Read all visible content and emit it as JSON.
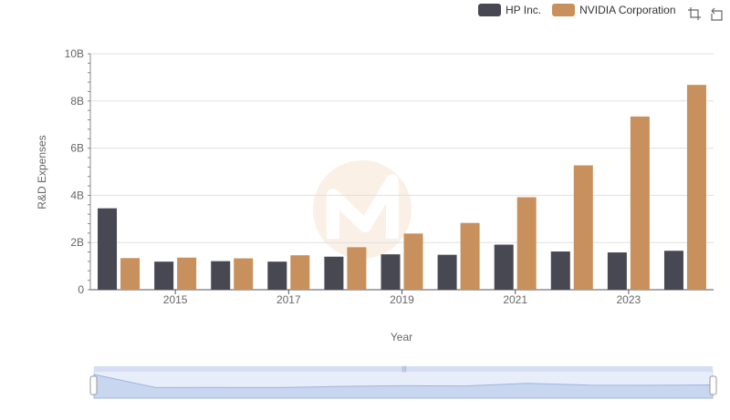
{
  "legend": {
    "items": [
      {
        "label": "HP Inc.",
        "color": "#484852"
      },
      {
        "label": "NVIDIA Corporation",
        "color": "#c8905c"
      }
    ]
  },
  "toolbox": {
    "icons": [
      "zoom-icon",
      "restore-icon"
    ]
  },
  "chart_data": {
    "type": "bar",
    "xlabel": "Year",
    "ylabel": "R&D Expenses",
    "categories": [
      "2014",
      "2015",
      "2016",
      "2017",
      "2018",
      "2019",
      "2020",
      "2021",
      "2022",
      "2023",
      "2024"
    ],
    "x_tick_labels": [
      "2015",
      "2017",
      "2019",
      "2021",
      "2023"
    ],
    "y_tick_labels": [
      "0",
      "2B",
      "4B",
      "6B",
      "8B",
      "10B"
    ],
    "ylim": [
      0,
      10000000000
    ],
    "series": [
      {
        "name": "HP Inc.",
        "color": "#484852",
        "values": [
          3450000000,
          1190000000,
          1210000000,
          1190000000,
          1400000000,
          1500000000,
          1480000000,
          1910000000,
          1620000000,
          1580000000,
          1650000000
        ]
      },
      {
        "name": "NVIDIA Corporation",
        "color": "#c8905c",
        "values": [
          1340000000,
          1360000000,
          1330000000,
          1460000000,
          1800000000,
          2380000000,
          2830000000,
          3920000000,
          5270000000,
          7340000000,
          8680000000
        ]
      }
    ],
    "grid": true,
    "legend_position": "top-right",
    "data_zoom": true
  }
}
